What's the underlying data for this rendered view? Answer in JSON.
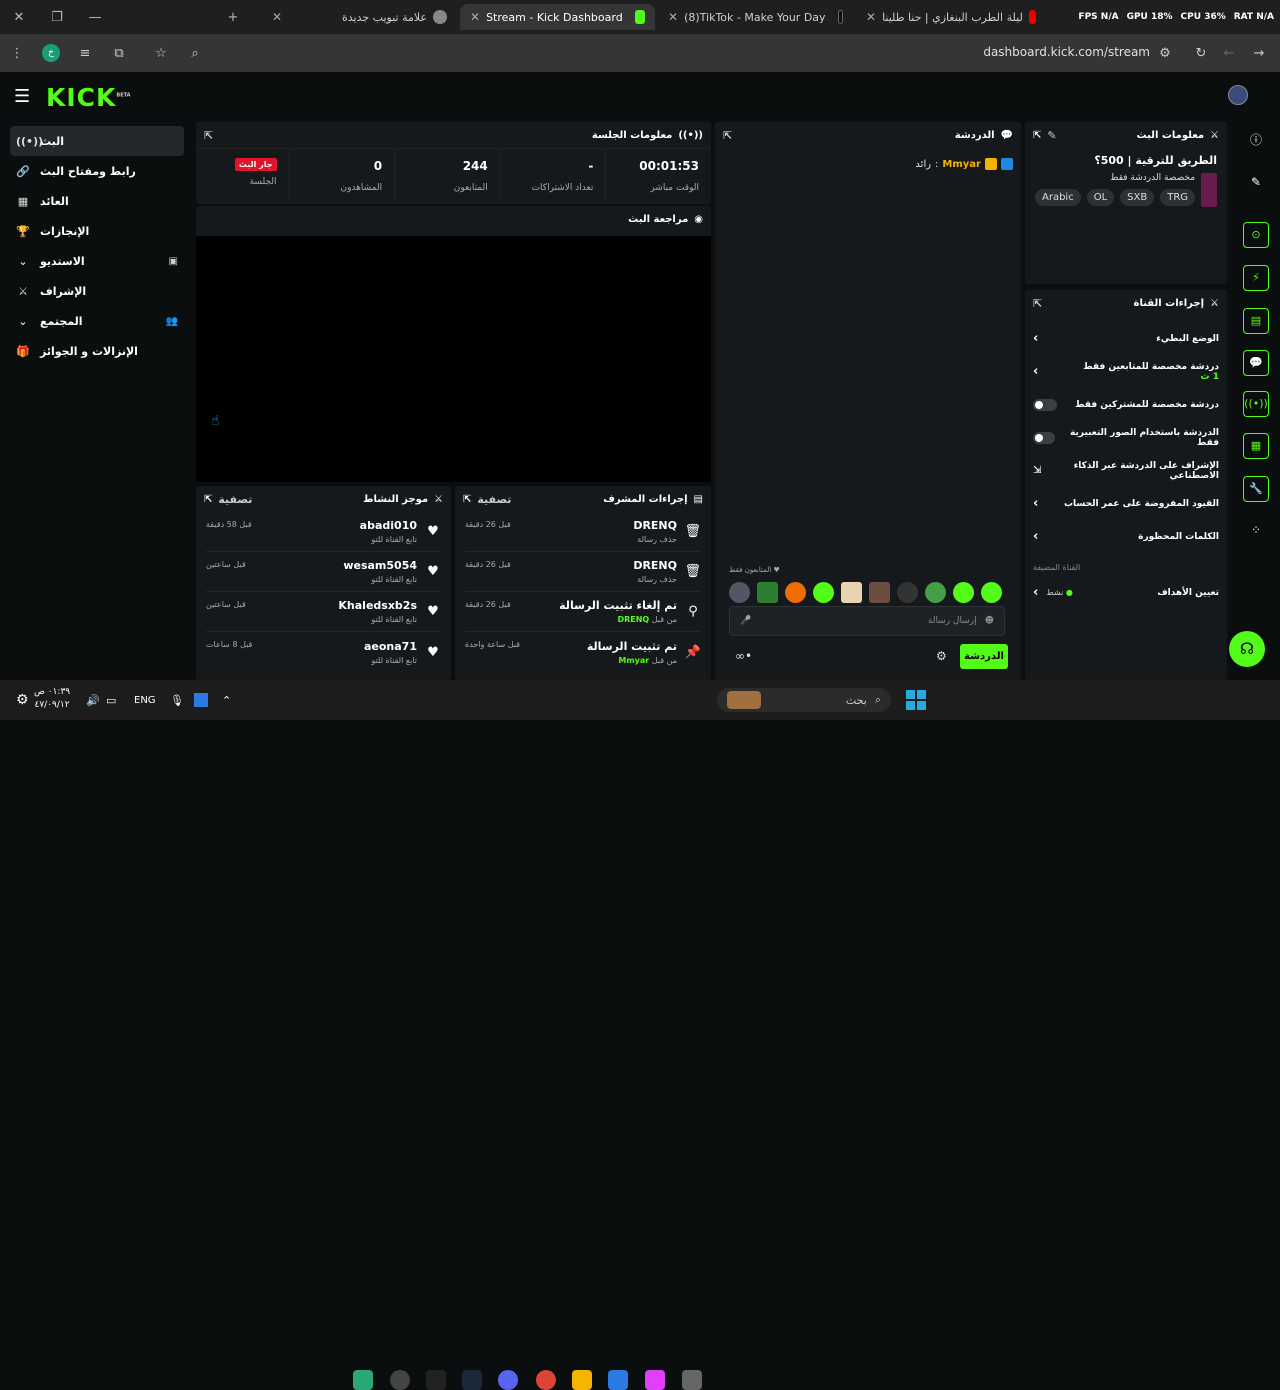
{
  "browser": {
    "tabs": [
      {
        "title": "علامة تبويب جديدة"
      },
      {
        "title": "Stream - Kick Dashboard"
      },
      {
        "title": "(8)TikTok - Make Your Day"
      },
      {
        "title": "ليلة الطرب البنغازي | حنا طلينا"
      }
    ],
    "perf": {
      "fps": "FPS N/A",
      "gpu": "GPU 18%",
      "cpu": "CPU 36%",
      "rat": "RAT N/A"
    },
    "url": "dashboard.kick.com/stream"
  },
  "brand": {
    "name": "KICK",
    "beta": "BETA",
    "accent": "#53fc18"
  },
  "nav": {
    "items": [
      {
        "label": "البث",
        "icon": "live-icon"
      },
      {
        "label": "رابط ومفتاح البث",
        "icon": "link-icon"
      },
      {
        "label": "العائد",
        "icon": "chart-icon"
      },
      {
        "label": "الإنجازات",
        "icon": "trophy-icon"
      },
      {
        "label": "الاستديو",
        "icon": "chevron-down-icon"
      },
      {
        "label": "الإشراف",
        "icon": "sword-icon"
      },
      {
        "label": "المجتمع",
        "icon": "chevron-down-icon"
      },
      {
        "label": "الإنزالات و الجوائز",
        "icon": "gift-icon"
      }
    ]
  },
  "session": {
    "title": "معلومات الجلسة",
    "live_badge": "جار البث",
    "stats": [
      {
        "value": "00:01:53",
        "label": "الوقت مباشر"
      },
      {
        "value": "-",
        "label": "تعداد الاشتراكات"
      },
      {
        "value": "244",
        "label": "المتابعون"
      },
      {
        "value": "0",
        "label": "المشاهدون"
      },
      {
        "value": "",
        "label": "الجلسة"
      }
    ]
  },
  "preview": {
    "title": "مراجعة البث"
  },
  "activity": {
    "title": "موجز النشاط",
    "filter": "تصفية",
    "rows": [
      {
        "name": "abadi010",
        "sub": "تابع القناة للتو",
        "time": "قبل 58 دقيقة"
      },
      {
        "name": "wesam5054",
        "sub": "تابع القناة للتو",
        "time": "قبل ساعتين"
      },
      {
        "name": "Khaledsxb2s",
        "sub": "تابع القناة للتو",
        "time": "قبل ساعتين"
      },
      {
        "name": "aeona71",
        "sub": "تابع القناة للتو",
        "time": "قبل 8 ساعات"
      }
    ]
  },
  "modactions": {
    "title": "إجراءات المشرف",
    "filter": "تصفية",
    "rows": [
      {
        "name": "DRENQ",
        "sub": "حذف رسالة",
        "time": "قبل 26 دقيقة",
        "by": ""
      },
      {
        "name": "DRENQ",
        "sub": "حذف رسالة",
        "time": "قبل 26 دقيقة",
        "by": ""
      },
      {
        "name": "تم إلغاء تثبيت الرسالة",
        "sub": "من قبل",
        "time": "قبل 26 دقيقة",
        "by": "DRENQ"
      },
      {
        "name": "تم تثبيت الرسالة",
        "sub": "من قبل",
        "time": "قبل ساعة واحدة",
        "by": "Mmyar"
      }
    ]
  },
  "chat": {
    "title": "الدردشة",
    "message_user": "Mmyar",
    "message_text": "رائد",
    "followers_only": "المتابعون فقط",
    "input_placeholder": "إرسال رسالة",
    "send_label": "الدردشة"
  },
  "streaminfo": {
    "title": "معلومات البث",
    "stream_title": "الطريق للترقية | 500؟",
    "category": "مخصصة الدردشة فقط",
    "tags": [
      "TRG",
      "SXB",
      "OL",
      "Arabic"
    ]
  },
  "channelactions": {
    "title": "إجراءات القناة",
    "rows": [
      {
        "label": "الوضع البطيء",
        "control": "arrow"
      },
      {
        "label": "دردشة مخصصة للمتابعين فقط",
        "control": "arrow",
        "sub": "1 ث"
      },
      {
        "label": "دردشة مخصصة للمشتركين فقط",
        "control": "toggle"
      },
      {
        "label": "الدردشة باستخدام الصور التعبيرية فقط",
        "control": "toggle"
      },
      {
        "label": "الإشراف على الدردشة عبر الذكاء الاصطناعي",
        "control": "external"
      },
      {
        "label": "القيود المفروضة على عمر الحساب",
        "control": "arrow"
      },
      {
        "label": "الكلمات المحظورة",
        "control": "arrow"
      }
    ],
    "section_label": "القناة المضيفة",
    "goals_label": "تعيين الأهداف",
    "goals_status": "نشط"
  },
  "taskbar": {
    "time": "٠١:٣٩ ص",
    "date": "٤٧/٠٩/١٢",
    "lang": "ENG",
    "search": "بحث"
  }
}
